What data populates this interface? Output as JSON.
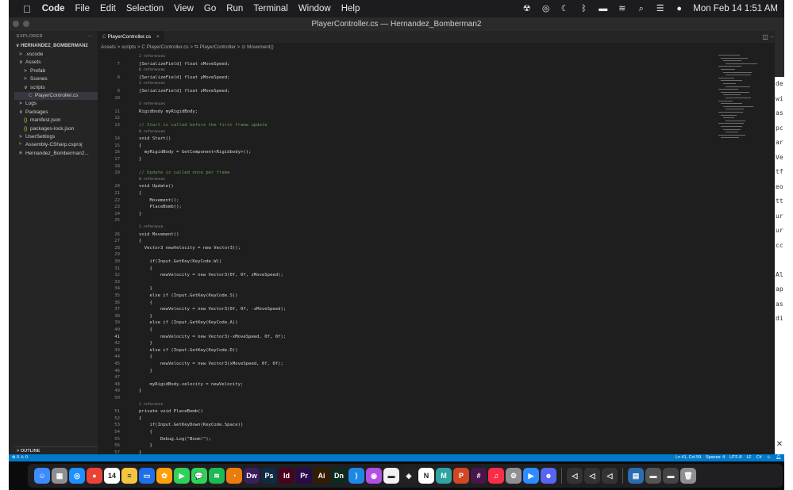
{
  "menubar": {
    "apple": "",
    "items": [
      "Code",
      "File",
      "Edit",
      "Selection",
      "View",
      "Go",
      "Run",
      "Terminal",
      "Window",
      "Help"
    ],
    "clock": "Mon Feb 14  1:51 AM",
    "status_icons": [
      "radiation-icon",
      "creative-cloud-icon",
      "moon-icon",
      "bluetooth-icon",
      "battery-icon",
      "wifi-icon",
      "search-icon",
      "control-center-icon",
      "siri-icon"
    ]
  },
  "window": {
    "title": "PlayerController.cs — Hernandez_Bomberman2"
  },
  "explorer": {
    "header": "EXPLORER",
    "more": "···",
    "project": "HERNANDEZ_BOMBERMAN2",
    "items": [
      {
        "icon": ">",
        "label": ".vscode"
      },
      {
        "icon": "∨",
        "label": "Assets"
      },
      {
        "icon": ">",
        "label": "Prefab"
      },
      {
        "icon": ">",
        "label": "Scenes"
      },
      {
        "icon": "∨",
        "label": "scripts"
      },
      {
        "icon": "C",
        "label": "PlayerController.cs"
      },
      {
        "icon": ">",
        "label": "Logs"
      },
      {
        "icon": "∨",
        "label": "Packages"
      },
      {
        "icon": "{}",
        "label": "manifest.json"
      },
      {
        "icon": "{}",
        "label": "packages-lock.json"
      },
      {
        "icon": ">",
        "label": "UserSettings"
      },
      {
        "icon": "ᴺ",
        "label": "Assembly-CSharp.csproj"
      },
      {
        "icon": "≡",
        "label": "Hernandez_Bomberman2..."
      }
    ],
    "outline": "OUTLINE"
  },
  "tab": {
    "icon": "C",
    "label": "PlayerController.cs",
    "close": "×"
  },
  "breadcrumb": "Assets > scripts > C PlayerController.cs > ⇆ PlayerController > ⊙ Movement()",
  "code_lines": [
    {
      "ln": "",
      "text": "2 references",
      "cls": "ref"
    },
    {
      "ln": "7",
      "text": "[SerializeField] float xMoveSpeed;",
      "cls": ""
    },
    {
      "ln": "",
      "text": "0 references",
      "cls": "ref"
    },
    {
      "ln": "8",
      "text": "[SerializeField] float yMoveSpeed;",
      "cls": ""
    },
    {
      "ln": "",
      "text": "2 references",
      "cls": "ref"
    },
    {
      "ln": "9",
      "text": "[SerializeField] float zMoveSpeed;",
      "cls": ""
    },
    {
      "ln": "10",
      "text": "",
      "cls": ""
    },
    {
      "ln": "",
      "text": "3 references",
      "cls": "ref"
    },
    {
      "ln": "11",
      "text": "Rigidbody myRigidBody;",
      "cls": ""
    },
    {
      "ln": "12",
      "text": "",
      "cls": ""
    },
    {
      "ln": "13",
      "text": "// Start is called before the first frame update",
      "cls": "comment"
    },
    {
      "ln": "",
      "text": "0 references",
      "cls": "ref"
    },
    {
      "ln": "14",
      "text": "void Start()",
      "cls": ""
    },
    {
      "ln": "15",
      "text": "{",
      "cls": ""
    },
    {
      "ln": "16",
      "text": "  myRigidBody = GetComponent<Rigidbody>();",
      "cls": ""
    },
    {
      "ln": "17",
      "text": "}",
      "cls": ""
    },
    {
      "ln": "18",
      "text": "",
      "cls": ""
    },
    {
      "ln": "19",
      "text": "// Update is called once per frame",
      "cls": "comment"
    },
    {
      "ln": "",
      "text": "0 references",
      "cls": "ref"
    },
    {
      "ln": "20",
      "text": "void Update()",
      "cls": ""
    },
    {
      "ln": "21",
      "text": "{",
      "cls": ""
    },
    {
      "ln": "22",
      "text": "    Movement();",
      "cls": ""
    },
    {
      "ln": "23",
      "text": "    PlaceBomb();",
      "cls": ""
    },
    {
      "ln": "24",
      "text": "}",
      "cls": ""
    },
    {
      "ln": "25",
      "text": "",
      "cls": ""
    },
    {
      "ln": "",
      "text": "1 reference",
      "cls": "ref"
    },
    {
      "ln": "26",
      "text": "void Movement()",
      "cls": ""
    },
    {
      "ln": "27",
      "text": "{",
      "cls": ""
    },
    {
      "ln": "28",
      "text": "  Vector3 newVelocity = new Vector3();",
      "cls": ""
    },
    {
      "ln": "29",
      "text": "",
      "cls": ""
    },
    {
      "ln": "30",
      "text": "    if(Input.GetKey(KeyCode.W))",
      "cls": ""
    },
    {
      "ln": "31",
      "text": "    {",
      "cls": ""
    },
    {
      "ln": "32",
      "text": "        newVelocity = new Vector3(0f, 0f, zMoveSpeed);",
      "cls": ""
    },
    {
      "ln": "33",
      "text": "",
      "cls": ""
    },
    {
      "ln": "34",
      "text": "    }",
      "cls": ""
    },
    {
      "ln": "35",
      "text": "    else if (Input.GetKey(KeyCode.S))",
      "cls": ""
    },
    {
      "ln": "36",
      "text": "    {",
      "cls": ""
    },
    {
      "ln": "37",
      "text": "        newVelocity = new Vector3(0f, 0f, -zMoveSpeed);",
      "cls": ""
    },
    {
      "ln": "38",
      "text": "    }",
      "cls": ""
    },
    {
      "ln": "39",
      "text": "    else if (Input.GetKey(KeyCode.A))",
      "cls": ""
    },
    {
      "ln": "40",
      "text": "    {",
      "cls": ""
    },
    {
      "ln": "41",
      "text": "        newVelocity = new Vector3(-xMoveSpeed, 0f, 0f);",
      "cls": "",
      "cur": true
    },
    {
      "ln": "42",
      "text": "    }",
      "cls": ""
    },
    {
      "ln": "43",
      "text": "    else if (Input.GetKey(KeyCode.D))",
      "cls": ""
    },
    {
      "ln": "44",
      "text": "    {",
      "cls": ""
    },
    {
      "ln": "45",
      "text": "        newVelocity = new Vector3(xMoveSpeed, 0f, 0f);",
      "cls": ""
    },
    {
      "ln": "46",
      "text": "    }",
      "cls": ""
    },
    {
      "ln": "47",
      "text": "",
      "cls": ""
    },
    {
      "ln": "48",
      "text": "    myRigidBody.velocity = newVelocity;",
      "cls": ""
    },
    {
      "ln": "49",
      "text": "}",
      "cls": ""
    },
    {
      "ln": "50",
      "text": "",
      "cls": ""
    },
    {
      "ln": "",
      "text": "1 reference",
      "cls": "ref"
    },
    {
      "ln": "51",
      "text": "private void PlaceBomb()",
      "cls": ""
    },
    {
      "ln": "52",
      "text": "{",
      "cls": ""
    },
    {
      "ln": "53",
      "text": "    if(Input.GetKeyDown(KeyCode.Space))",
      "cls": ""
    },
    {
      "ln": "54",
      "text": "    {",
      "cls": ""
    },
    {
      "ln": "55",
      "text": "        Debug.Log(\"Boom!\");",
      "cls": ""
    },
    {
      "ln": "56",
      "text": "    }",
      "cls": ""
    },
    {
      "ln": "57",
      "text": "}",
      "cls": ""
    }
  ],
  "statusbar": {
    "left": "⊗ 0  ⚠ 0",
    "position": "Ln 41, Col 59",
    "spaces": "Spaces: 4",
    "encoding": "UTF-8",
    "eol": "LF",
    "language": "C#"
  },
  "background_window_chars": [
    "de",
    "wi",
    "as",
    "pc",
    "ar",
    "Ve",
    "tf",
    "eo",
    "tt",
    "ur",
    "ur",
    "cc",
    "",
    "Al",
    "ap",
    "as",
    "di"
  ],
  "dock": [
    {
      "name": "finder-icon",
      "label": "☺",
      "color": "#3d8bfd"
    },
    {
      "name": "launchpad-icon",
      "label": "▦",
      "color": "#8e8e93"
    },
    {
      "name": "safari-icon",
      "label": "◎",
      "color": "#1e90ff"
    },
    {
      "name": "chrome-icon",
      "label": "●",
      "color": "#ea4335"
    },
    {
      "name": "calendar-icon",
      "label": "14",
      "color": "#ffffff"
    },
    {
      "name": "notes-icon",
      "label": "≡",
      "color": "#f5c542"
    },
    {
      "name": "keynote-icon",
      "label": "▭",
      "color": "#1f6feb"
    },
    {
      "name": "photos-icon",
      "label": "✿",
      "color": "#ff9f0a"
    },
    {
      "name": "facetime-icon",
      "label": "▶",
      "color": "#30d158"
    },
    {
      "name": "messages-icon",
      "label": "💬",
      "color": "#30d158"
    },
    {
      "name": "spotify-icon",
      "label": "≋",
      "color": "#1db954"
    },
    {
      "name": "blender-icon",
      "label": "◔",
      "color": "#e87d0d"
    },
    {
      "name": "dreamweaver-icon",
      "label": "Dw",
      "color": "#3a1f5c"
    },
    {
      "name": "photoshop-icon",
      "label": "Ps",
      "color": "#0f2a44"
    },
    {
      "name": "indesign-icon",
      "label": "Id",
      "color": "#49021f"
    },
    {
      "name": "premiere-icon",
      "label": "Pr",
      "color": "#2a0a4a"
    },
    {
      "name": "illustrator-icon",
      "label": "Ai",
      "color": "#331c00"
    },
    {
      "name": "dimension-icon",
      "label": "Dn",
      "color": "#0d2b1e"
    },
    {
      "name": "vscode-icon",
      "label": "⟩",
      "color": "#1e88e5"
    },
    {
      "name": "podcast-icon",
      "label": "◉",
      "color": "#b150e2"
    },
    {
      "name": "unknown-app-icon",
      "label": "▬",
      "color": "#f2f2f2"
    },
    {
      "name": "unity-hub-icon",
      "label": "◈",
      "color": "#222222"
    },
    {
      "name": "notion-icon",
      "label": "N",
      "color": "#ffffff"
    },
    {
      "name": "maya-icon",
      "label": "M",
      "color": "#2fa4a4"
    },
    {
      "name": "powerpoint-icon",
      "label": "P",
      "color": "#d24726"
    },
    {
      "name": "slack-icon",
      "label": "#",
      "color": "#4a154b"
    },
    {
      "name": "music-icon",
      "label": "♫",
      "color": "#fa2d48"
    },
    {
      "name": "system-preferences-icon",
      "label": "⚙",
      "color": "#8e8e93"
    },
    {
      "name": "zoom-icon",
      "label": "▶",
      "color": "#2d8cff"
    },
    {
      "name": "discord-icon",
      "label": "☻",
      "color": "#5865f2"
    },
    {
      "name": "unity-icon-1",
      "label": "◁",
      "color": "#333333"
    },
    {
      "name": "unity-icon-2",
      "label": "◁",
      "color": "#333333"
    },
    {
      "name": "unity-icon-3",
      "label": "◁",
      "color": "#333333"
    },
    {
      "name": "document-icon",
      "label": "▤",
      "color": "#2b6cb0"
    },
    {
      "name": "window-thumb-1-icon",
      "label": "▬",
      "color": "#555555"
    },
    {
      "name": "window-thumb-2-icon",
      "label": "▬",
      "color": "#444444"
    },
    {
      "name": "trash-icon",
      "label": "🗑",
      "color": "#8e8e93"
    }
  ]
}
